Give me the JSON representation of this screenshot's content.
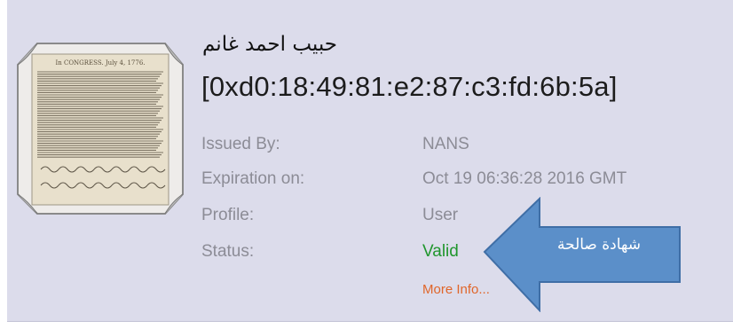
{
  "cert": {
    "name": "حبيب احمد غانم",
    "fingerprint": "[0xd0:18:49:81:e2:87:c3:fd:6b:5a]"
  },
  "fields": [
    {
      "label": "Issued By:",
      "value": "NANS"
    },
    {
      "label": "Expiration on:",
      "value": "Oct 19 06:36:28 2016 GMT"
    },
    {
      "label": "Profile:",
      "value": "User"
    },
    {
      "label": "Status:",
      "value": "Valid"
    }
  ],
  "more_info": "More Info...",
  "callout": {
    "text": "شهادة صالحة",
    "color": "#5b8fc9"
  },
  "colors": {
    "panel_bg": "#dcdceb",
    "valid": "#20962d",
    "link": "#e0662a"
  },
  "image": {
    "icon": "declaration-document-icon",
    "header_text": "In CONGRESS. July 4, 1776."
  }
}
